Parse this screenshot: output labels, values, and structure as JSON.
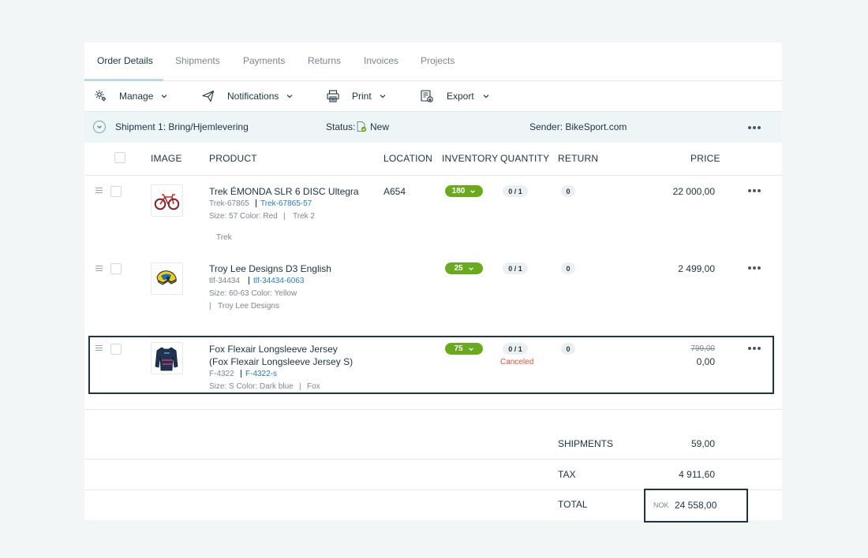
{
  "tabs": [
    {
      "label": "Order Details",
      "active": true
    },
    {
      "label": "Shipments"
    },
    {
      "label": "Payments"
    },
    {
      "label": "Returns"
    },
    {
      "label": "Invoices"
    },
    {
      "label": "Projects"
    }
  ],
  "toolbar": {
    "manage": {
      "label": "Manage",
      "icon": "gear-icon"
    },
    "notifications": {
      "label": "Notifications",
      "icon": "send-icon"
    },
    "print": {
      "label": "Print",
      "icon": "printer-icon"
    },
    "export": {
      "label": "Export",
      "icon": "export-icon"
    }
  },
  "shipment": {
    "title": "Shipment 1: Bring/Hjemlevering",
    "status_label": "Status:",
    "status_value": "New",
    "sender": "Sender: BikeSport.com"
  },
  "table": {
    "headers": {
      "image": "IMAGE",
      "product": "PRODUCT",
      "location": "LOCATION",
      "inventory": "INVENTORY",
      "quantity": "QUANTITY",
      "return": "RETURN",
      "price": "PRICE"
    },
    "rows": [
      {
        "name": "Trek ÉMONDA SLR 6 DISC Ultegra",
        "sku": "Trek-67865",
        "variant_sku": "Trek-67865-57",
        "attrs": "Size: 57   Color: Red",
        "brand_a": "Trek 2",
        "brand_b": "Trek",
        "location": "A654",
        "inventory": "180",
        "quantity": "0 / 1",
        "return": "0",
        "price": "22 000,00",
        "thumb_icon": "bicycle-image"
      },
      {
        "name": "Troy Lee Designs D3 English",
        "sku": "tlf-34434",
        "variant_sku": "tlf-34434-6063",
        "attrs": "Size: 60-63   Color: Yellow",
        "brand_a": "Troy Lee Designs",
        "location": "",
        "inventory": "25",
        "quantity": "0 / 1",
        "return": "0",
        "price": "2 499,00",
        "thumb_icon": "helmet-image"
      },
      {
        "name": "Fox Flexair Longsleeve Jersey",
        "name_line2": "(Fox Flexair Longsleeve Jersey S)",
        "sku": "F-4322",
        "variant_sku": "F-4322-s",
        "attrs": "Size: S   Color: Dark blue",
        "brand_a": "Fox",
        "location": "",
        "inventory": "75",
        "quantity": "0 / 1",
        "quantity_status": "Canceled",
        "return": "0",
        "price_original": "799,00",
        "price": "0,00",
        "thumb_icon": "jersey-image"
      }
    ]
  },
  "summary": {
    "shipments_label": "SHIPMENTS",
    "shipments_value": "59,00",
    "tax_label": "TAX",
    "tax_value": "4 911,60",
    "total_label": "TOTAL",
    "currency": "NOK",
    "total_value": "24 558,00"
  },
  "colors": {
    "accent": "#1d3442",
    "inventory_badge": "#6aaa1f",
    "link": "#2b7bbd",
    "canceled": "#e0533a",
    "shipment_bar": "#edf5f6"
  }
}
